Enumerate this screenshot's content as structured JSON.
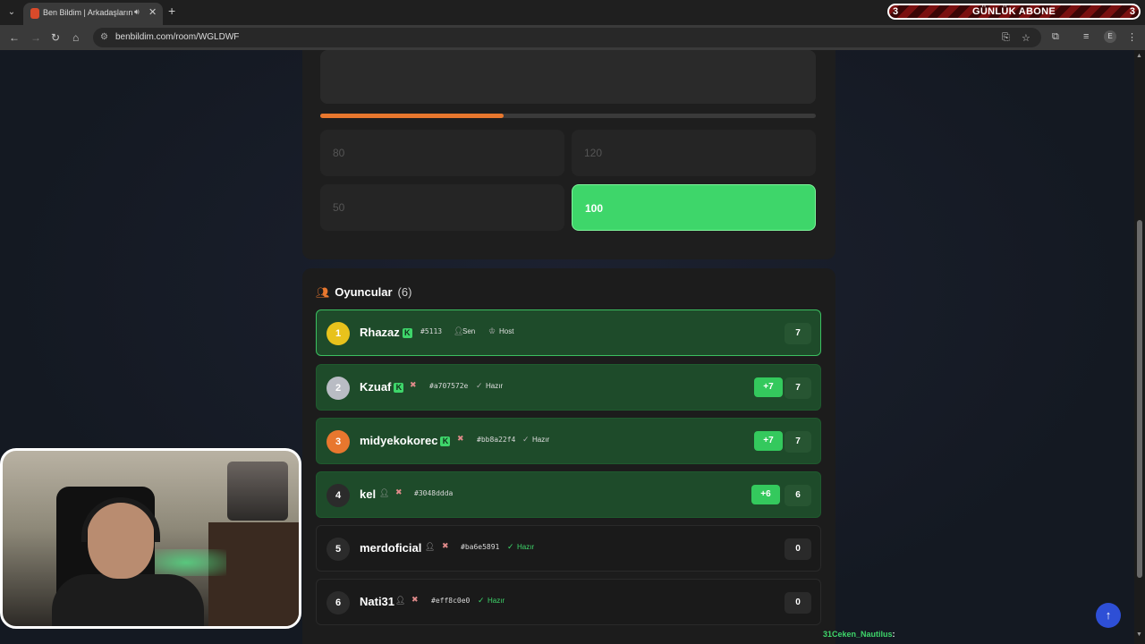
{
  "browser": {
    "tab_title": "Ben Bildim | Arkadaşlarınla",
    "url": "benbildim.com/room/WGLDWF",
    "profile_initial": "E"
  },
  "overlay_banner": {
    "left": "3",
    "label": "GÜNLÜK ABONE",
    "right": "3"
  },
  "question_card": {
    "progress_percent": 37,
    "options": [
      "80",
      "120",
      "50",
      "100"
    ],
    "selected_option": "100"
  },
  "players": {
    "title": "Oyuncular",
    "count": "(6)",
    "list": [
      {
        "rank": "1",
        "name": "Rhazaz",
        "id": "#5113",
        "tag1": "Sen",
        "tag2": "Host",
        "plus": "",
        "score": "7"
      },
      {
        "rank": "2",
        "name": "Kzuaf",
        "id": "#a707572e",
        "status": "Hazır",
        "plus": "+7",
        "score": "7"
      },
      {
        "rank": "3",
        "name": "midyekokorec",
        "id": "#bb8a22f4",
        "status": "Hazır",
        "plus": "+7",
        "score": "7"
      },
      {
        "rank": "4",
        "name": "kel",
        "id": "#3048ddda",
        "status": "",
        "plus": "+6",
        "score": "6"
      },
      {
        "rank": "5",
        "name": "merdoficial",
        "id": "#ba6e5891",
        "status": "Hazır",
        "plus": "",
        "score": "0"
      },
      {
        "rank": "6",
        "name": "Nati31",
        "id": "#eff8c0e0",
        "status": "Hazır",
        "plus": "",
        "score": "0"
      }
    ]
  },
  "chat_line": {
    "user": "31Ceken_Nautilus",
    "colon": ":"
  },
  "colors": {
    "accent_orange": "#e8772e",
    "green": "#3ed66a",
    "fab_blue": "#2e4fd6"
  }
}
